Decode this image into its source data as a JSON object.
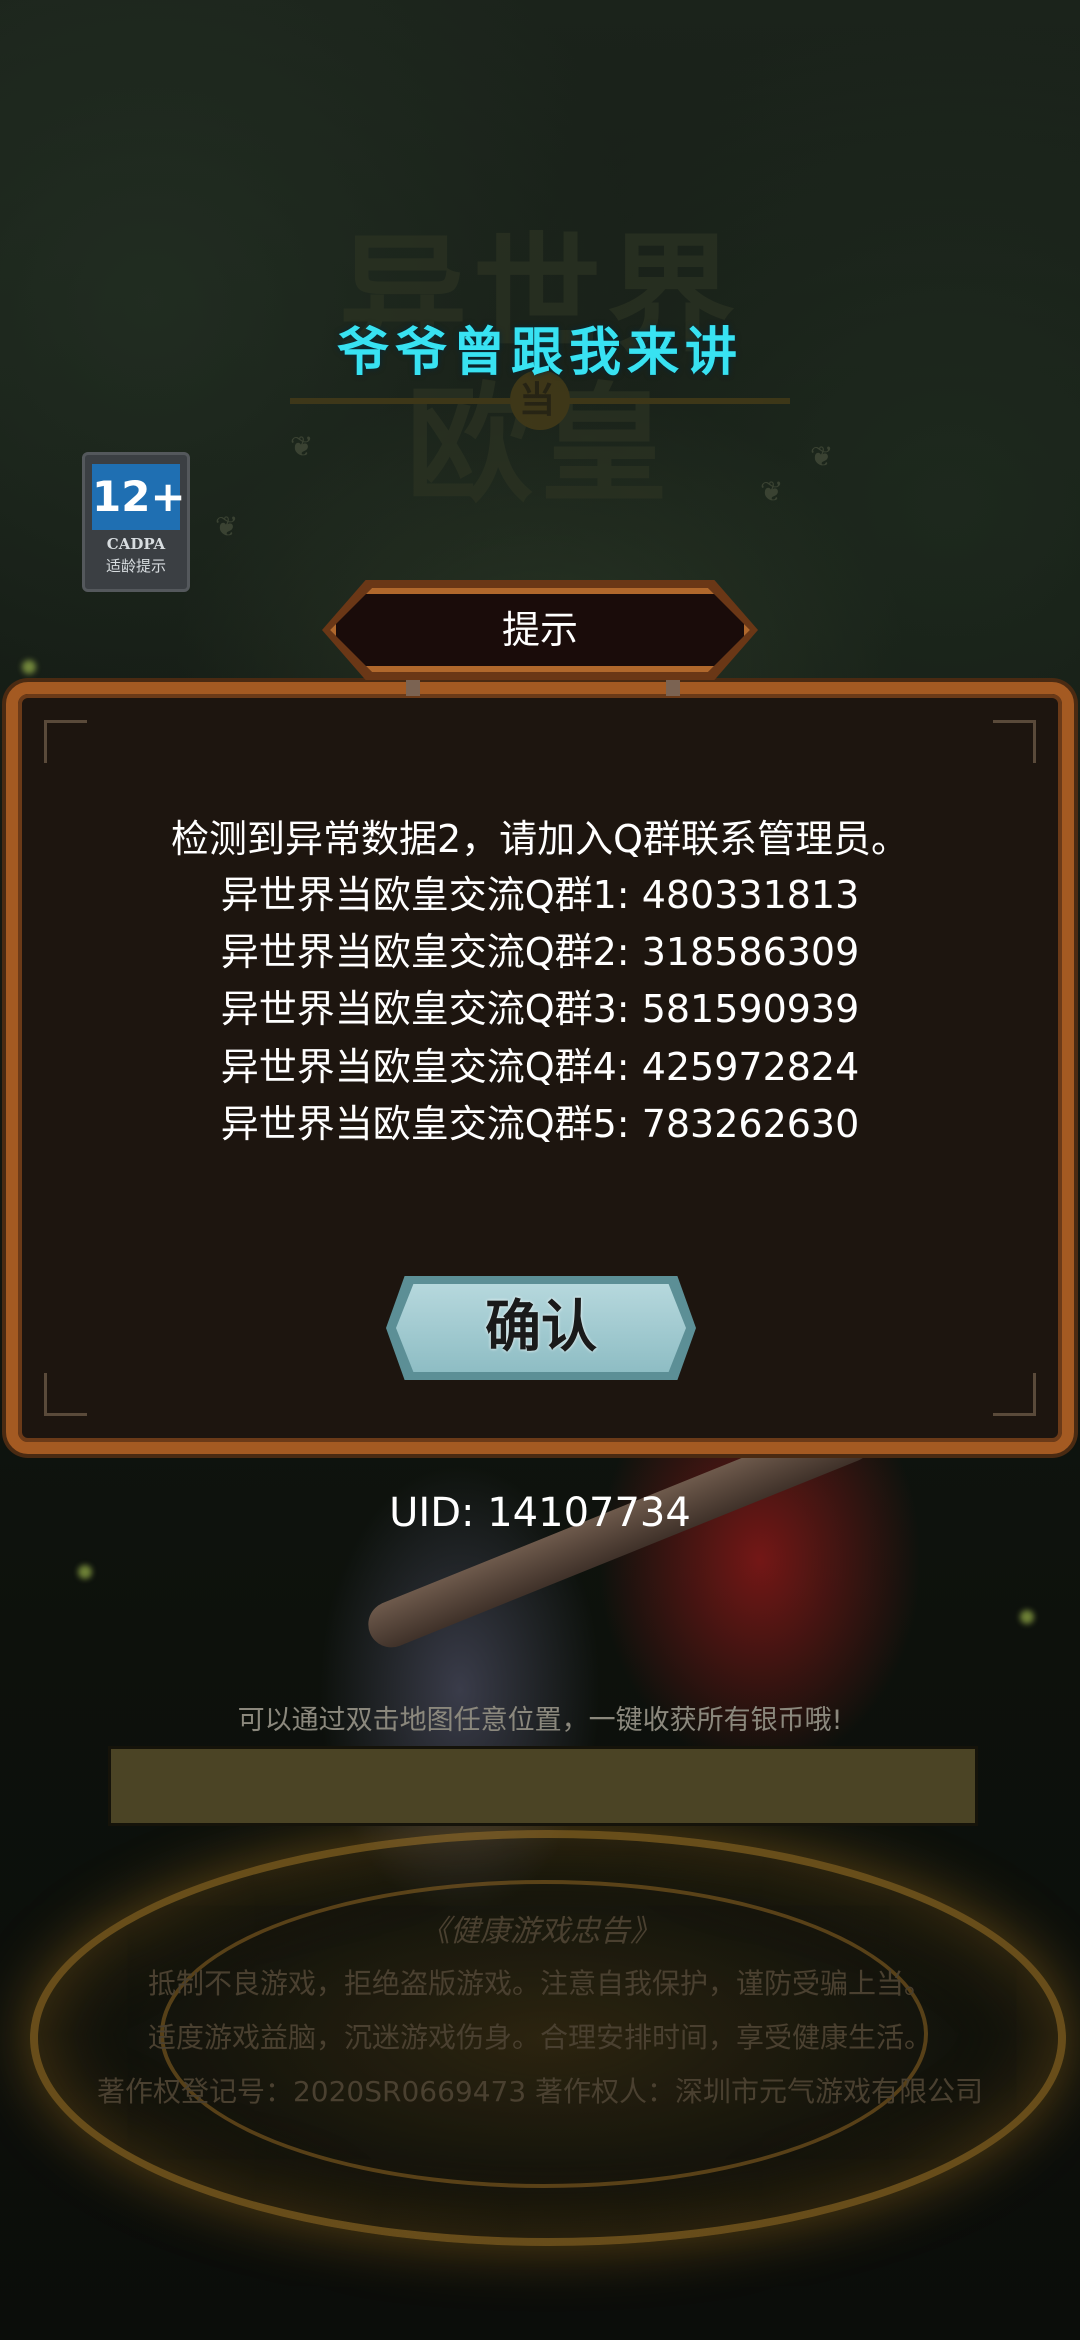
{
  "top_title": "爷爷曾跟我来讲",
  "age_rating": {
    "age": "12+",
    "org": "CADPA",
    "label": "适龄提示"
  },
  "background": {
    "logo_line1": "异世界",
    "logo_line2": "欧皇",
    "logo_badge": "当"
  },
  "dialog": {
    "title": "提示",
    "lines": [
      "检测到异常数据2，请加入Q群联系管理员。",
      "异世界当欧皇交流Q群1: 480331813",
      "异世界当欧皇交流Q群2: 318586309",
      "异世界当欧皇交流Q群3: 581590939",
      "异世界当欧皇交流Q群4: 425972824",
      "异世界当欧皇交流Q群5: 783262630"
    ],
    "confirm_label": "确认"
  },
  "uid": "UID: 14107734",
  "tip": "可以通过双击地图任意位置，一键收获所有银币哦!",
  "loading_progress": 0,
  "health_notice": {
    "title": "《健康游戏忠告》",
    "line1": "抵制不良游戏，拒绝盗版游戏。注意自我保护，谨防受骗上当。",
    "line2": "适度游戏益脑，沉迷游戏伤身。合理安排时间，享受健康生活。",
    "line3": "著作权登记号：2020SR0669473    著作权人：深圳市元气游戏有限公司"
  }
}
